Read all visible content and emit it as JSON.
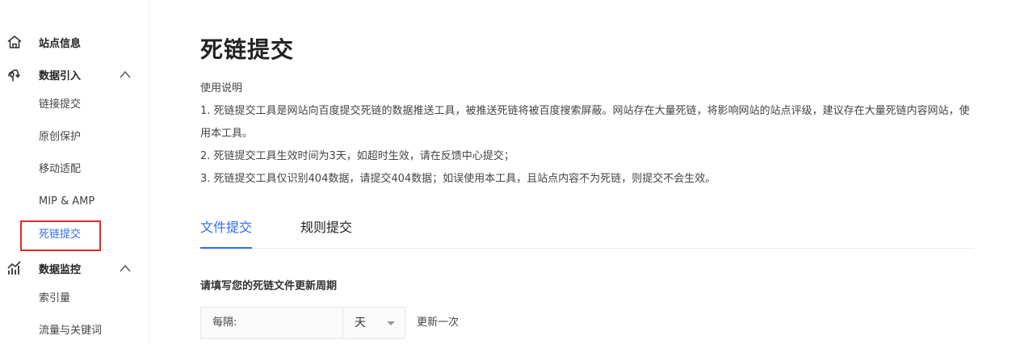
{
  "sidebar": {
    "groups": [
      {
        "label": "站点信息",
        "icon": "home-icon"
      },
      {
        "label": "数据引入",
        "icon": "data-import-icon",
        "expanded": true
      },
      {
        "label": "数据监控",
        "icon": "chart-icon",
        "expanded": true
      }
    ],
    "import_items": [
      "链接提交",
      "原创保护",
      "移动适配",
      "MIP & AMP",
      "死链提交"
    ],
    "monitor_items": [
      "索引量",
      "流量与关键词"
    ],
    "active_item": "死链提交"
  },
  "main": {
    "title": "死链提交",
    "intro": {
      "heading": "使用说明",
      "lines": [
        "1. 死链提交工具是网站向百度提交死链的数据推送工具，被推送死链将被百度搜索屏蔽。网站存在大量死链，将影响网站的站点评级，建议存在大量死链内容网站，使用本工具。",
        "2. 死链提交工具生效时间为3天，如超时生效，请在反馈中心提交；",
        "3. 死链提交工具仅识别404数据，请提交404数据；如误使用本工具，且站点内容不为死链，则提交不会生效。"
      ]
    },
    "tabs": [
      {
        "label": "文件提交",
        "active": true
      },
      {
        "label": "规则提交",
        "active": false
      }
    ],
    "form": {
      "section_label": "请填写您的死链文件更新周期",
      "every_prefix": "每隔:",
      "unit_value": "天",
      "suffix": "更新一次"
    }
  },
  "colors": {
    "accent": "#2f6ee8",
    "highlight_box": "#e02b2b"
  }
}
